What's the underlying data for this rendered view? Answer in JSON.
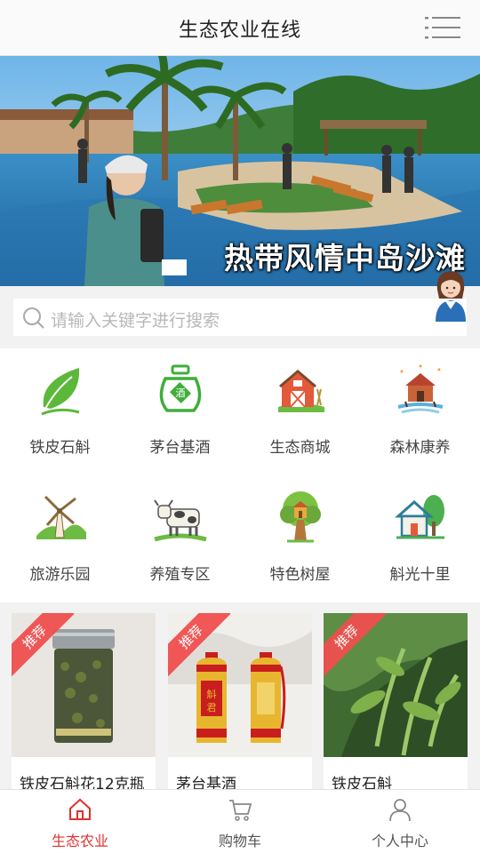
{
  "header": {
    "title": "生态农业在线",
    "menu_icon": "hamburger-menu-icon"
  },
  "banner": {
    "caption": "热带风情中岛沙滩"
  },
  "search": {
    "placeholder": "请输入关键字进行搜索"
  },
  "categories": [
    {
      "label": "铁皮石斛",
      "icon": "leaf-icon"
    },
    {
      "label": "茅台基酒",
      "icon": "wine-jar-icon"
    },
    {
      "label": "生态商城",
      "icon": "barn-icon"
    },
    {
      "label": "森林康养",
      "icon": "cabin-icon"
    },
    {
      "label": "旅游乐园",
      "icon": "windmill-icon"
    },
    {
      "label": "养殖专区",
      "icon": "cow-icon"
    },
    {
      "label": "特色树屋",
      "icon": "treehouse-icon"
    },
    {
      "label": "斛光十里",
      "icon": "house-tree-icon"
    }
  ],
  "products": [
    {
      "badge": "推荐",
      "name": "铁皮石斛花12克瓶"
    },
    {
      "badge": "推荐",
      "name": "茅台基酒",
      "bottle_label": "斛君"
    },
    {
      "badge": "推荐",
      "name": "铁皮石斛"
    }
  ],
  "tabs": [
    {
      "label": "生态农业",
      "icon": "home-icon",
      "active": true
    },
    {
      "label": "购物车",
      "icon": "cart-icon",
      "active": false
    },
    {
      "label": "个人中心",
      "icon": "user-icon",
      "active": false
    }
  ],
  "colors": {
    "accent": "#e0312f",
    "ribbon": "#f04f4f",
    "icon_green": "#4caf3a"
  }
}
